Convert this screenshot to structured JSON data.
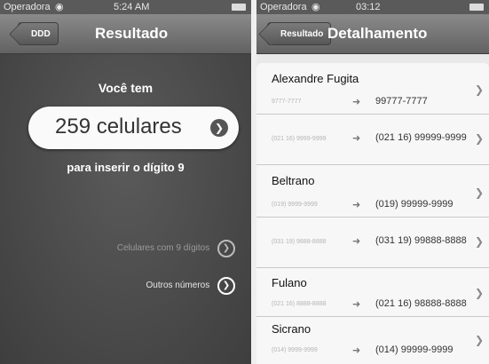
{
  "left_screen": {
    "status": {
      "carrier": "Operadora",
      "time": "5:24 AM"
    },
    "nav": {
      "back": "DDD",
      "title": "Resultado"
    },
    "intro": "Você tem",
    "count_label": "259 celulares",
    "subtext": "para inserir o dígito 9",
    "links": [
      {
        "label": "Celulares com 9 dígitos"
      },
      {
        "label": "Outros números"
      }
    ]
  },
  "right_screen": {
    "status": {
      "carrier": "Operadora",
      "time": "03:12"
    },
    "nav": {
      "back": "Resultado",
      "title": "Detalhamento"
    },
    "contacts": [
      {
        "name": "Alexandre Fugita",
        "entries": [
          {
            "old": "9777-7777",
            "new": "99777-7777"
          },
          {
            "old": "(021 16) 9999-9999",
            "new": "(021 16) 99999-9999"
          }
        ]
      },
      {
        "name": "Beltrano",
        "entries": [
          {
            "old": "(019) 9999-9999",
            "new": "(019) 99999-9999"
          },
          {
            "old": "(031 19) 9888-8888",
            "new": "(031 19) 99888-8888"
          }
        ]
      },
      {
        "name": "Fulano",
        "entries": [
          {
            "old": "(021 16) 8888-8888",
            "new": "(021 16) 98888-8888"
          }
        ]
      },
      {
        "name": "Sicrano",
        "entries": [
          {
            "old": "(014) 9999-9999",
            "new": "(014) 99999-9999"
          }
        ]
      }
    ]
  },
  "icons": {
    "arrow": "arrow-right-icon",
    "chevron": "chevron-right-icon",
    "wifi": "wifi-icon",
    "battery": "battery-icon"
  }
}
